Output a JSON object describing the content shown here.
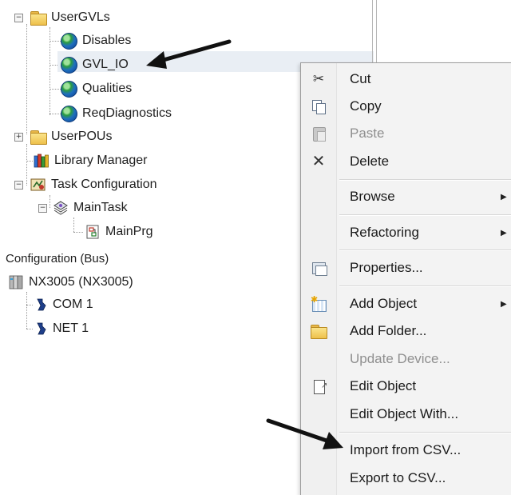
{
  "tree": {
    "items": [
      {
        "label": "UserGVLs",
        "icon": "folder-icon",
        "toggle": "−"
      },
      {
        "label": "Disables",
        "icon": "gvl-globe-icon"
      },
      {
        "label": "GVL_IO",
        "icon": "gvl-globe-icon",
        "selected": true
      },
      {
        "label": "Qualities",
        "icon": "gvl-globe-icon"
      },
      {
        "label": "ReqDiagnostics",
        "icon": "gvl-globe-icon"
      },
      {
        "label": "UserPOUs",
        "icon": "folder-icon",
        "toggle": "+"
      },
      {
        "label": "Library Manager",
        "icon": "library-icon"
      },
      {
        "label": "Task Configuration",
        "icon": "task-configuration-icon",
        "toggle": "−"
      },
      {
        "label": "MainTask",
        "icon": "task-icon",
        "toggle": "−"
      },
      {
        "label": "MainPrg",
        "icon": "program-icon"
      },
      {
        "label": "Configuration (Bus)"
      },
      {
        "label": "NX3005 (NX3005)",
        "icon": "device-icon",
        "toggle": "−"
      },
      {
        "label": "COM 1",
        "icon": "port-icon"
      },
      {
        "label": "NET 1",
        "icon": "port-icon"
      }
    ]
  },
  "context_menu": {
    "items": [
      {
        "label": "Cut",
        "icon": "scissors-icon",
        "enabled": true
      },
      {
        "label": "Copy",
        "icon": "copy-icon",
        "enabled": true
      },
      {
        "label": "Paste",
        "icon": "paste-icon",
        "enabled": false
      },
      {
        "label": "Delete",
        "icon": "delete-x-icon",
        "enabled": true
      },
      {
        "label": "Browse",
        "submenu": true,
        "enabled": true
      },
      {
        "label": "Refactoring",
        "submenu": true,
        "enabled": true
      },
      {
        "label": "Properties...",
        "icon": "properties-icon",
        "enabled": true
      },
      {
        "label": "Add Object",
        "icon": "add-object-icon",
        "submenu": true,
        "enabled": true
      },
      {
        "label": "Add Folder...",
        "icon": "folder-icon",
        "enabled": true
      },
      {
        "label": "Update Device...",
        "enabled": false
      },
      {
        "label": "Edit Object",
        "icon": "edit-object-icon",
        "enabled": true
      },
      {
        "label": "Edit Object With...",
        "enabled": true
      },
      {
        "label": "Import from CSV...",
        "enabled": true
      },
      {
        "label": "Export to CSV...",
        "enabled": true
      }
    ]
  },
  "annotations": {
    "arrow_color": "#111111",
    "arrows": [
      "arrow pointing to GVL_IO",
      "arrow pointing to Import from CSV..."
    ]
  }
}
